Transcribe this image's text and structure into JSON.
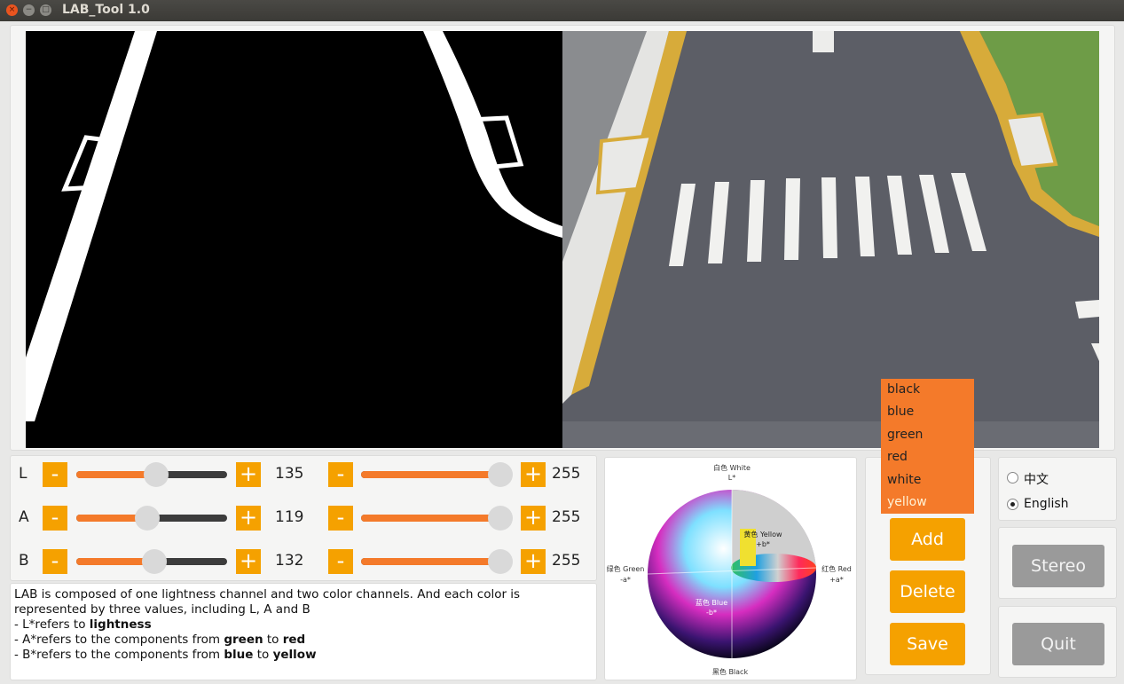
{
  "window": {
    "title": "LAB_Tool 1.0",
    "close_glyph": "×",
    "min_glyph": "−",
    "max_glyph": "□"
  },
  "sliders": {
    "minus_label": "-",
    "plus_label": "+",
    "rows": [
      {
        "channel": "L",
        "min_value": "135",
        "max_value": "255",
        "min_fraction": 0.53,
        "max_fraction": 1.0
      },
      {
        "channel": "A",
        "min_value": "119",
        "max_value": "255",
        "min_fraction": 0.47,
        "max_fraction": 1.0
      },
      {
        "channel": "B",
        "min_value": "132",
        "max_value": "255",
        "min_fraction": 0.52,
        "max_fraction": 1.0
      }
    ]
  },
  "description": {
    "line1": "LAB is composed of one lightness channel and two color channels. And each color is represented by three values, including L, A and B",
    "l_prefix": "- L*refers to ",
    "l_bold": "lightness",
    "a_prefix": "- A*refers to the components from ",
    "a_bold1": "green",
    "a_mid": " to ",
    "a_bold2": "red",
    "b_prefix": "- B*refers to the components from ",
    "b_bold1": "blue",
    "b_mid": " to ",
    "b_bold2": "yellow"
  },
  "sphere": {
    "white": "白色 White",
    "l_axis": "L*",
    "yellow": "黄色 Yellow",
    "plus_b": "+b*",
    "green": "绿色 Green",
    "minus_a": "-a*",
    "red": "红色 Red",
    "plus_a": "+a*",
    "blue": "蓝色 Blue",
    "minus_b": "-b*",
    "black": "黑色 Black"
  },
  "dropdown": {
    "items": [
      "black",
      "blue",
      "green",
      "red",
      "white",
      "yellow"
    ],
    "highlighted": "yellow"
  },
  "actions": {
    "add": "Add",
    "delete": "Delete",
    "save": "Save"
  },
  "language": {
    "chinese": "中文",
    "english": "English",
    "selected": "English"
  },
  "side": {
    "stereo": "Stereo",
    "quit": "Quit"
  },
  "colors": {
    "orange": "#f5a100",
    "slider_fill": "#f47a2a",
    "dropdown_bg": "#f47a2a",
    "disabled_gray": "#9a9a9a"
  }
}
